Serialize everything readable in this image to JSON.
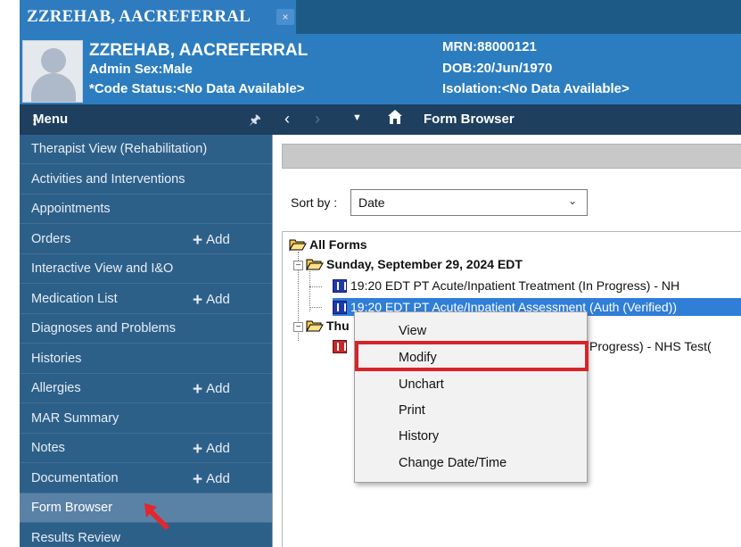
{
  "tab": {
    "title": "ZZREHAB, AACREFERRAL",
    "close": "×"
  },
  "banner": {
    "name": "ZZREHAB, AACREFERRAL",
    "admin_sex": "Admin Sex:Male",
    "code_status": "*Code Status:<No Data Available>",
    "mrn": "MRN:88000121",
    "dob": "DOB:20/Jun/1970",
    "isolation": "Isolation:<No Data Available>"
  },
  "menu": {
    "title": "Menu",
    "items": [
      {
        "label": "Therapist View (Rehabilitation)",
        "add": ""
      },
      {
        "label": "Activities and Interventions",
        "add": ""
      },
      {
        "label": "Appointments",
        "add": ""
      },
      {
        "label": "Orders",
        "add": "Add"
      },
      {
        "label": "Interactive View and I&O",
        "add": ""
      },
      {
        "label": "Medication List",
        "add": "Add"
      },
      {
        "label": "Diagnoses and Problems",
        "add": ""
      },
      {
        "label": "Histories",
        "add": ""
      },
      {
        "label": "Allergies",
        "add": "Add"
      },
      {
        "label": "MAR Summary",
        "add": ""
      },
      {
        "label": "Notes",
        "add": "Add"
      },
      {
        "label": "Documentation",
        "add": "Add"
      },
      {
        "label": "Form Browser",
        "add": ""
      },
      {
        "label": "Results Review",
        "add": ""
      }
    ],
    "active_index": 12
  },
  "toolbar": {
    "title": "Form Browser"
  },
  "sort": {
    "label": "Sort by :",
    "value": "Date"
  },
  "tree": {
    "root": "All Forms",
    "day1": "Sunday, September 29, 2024 EDT",
    "form1": "19:20 EDT PT Acute/Inpatient Treatment (In Progress) - NH",
    "form2": "19:20 EDT PT Acute/Inpatient Assessment (Auth (Verified))",
    "day2_partial": "Thu",
    "form3_partial": "Progress) - NHS Test("
  },
  "context_menu": {
    "items": [
      "View",
      "Modify",
      "Unchart",
      "Print",
      "History",
      "Change Date/Time"
    ],
    "highlighted": "Modify"
  },
  "colors": {
    "banner": "#2c7dc0",
    "menu_bg": "#2d6089",
    "header_dark": "#1e3f5e",
    "highlight_red": "#d8232a",
    "selection": "#2f7ed8"
  }
}
